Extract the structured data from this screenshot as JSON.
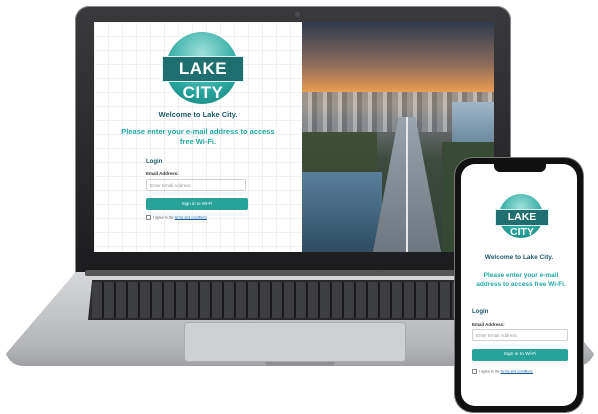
{
  "brand": {
    "logo_text": "LAKE CITY",
    "primary_color": "#27a39a",
    "heading_color": "#1d5a6a"
  },
  "portal": {
    "welcome": "Welcome to Lake City.",
    "instruction": "Please enter your e-mail address to access free Wi-Fi.",
    "login_heading": "Login",
    "email_label": "Email Address:",
    "email_placeholder": "Enter Email Address",
    "signin_button": "Sign in to Wi-Fi",
    "agree_prefix": "I agree to the",
    "agree_link": "terms and conditions"
  },
  "icons": {
    "logo": "lake-city-logo-icon",
    "checkbox": "checkbox-icon"
  }
}
